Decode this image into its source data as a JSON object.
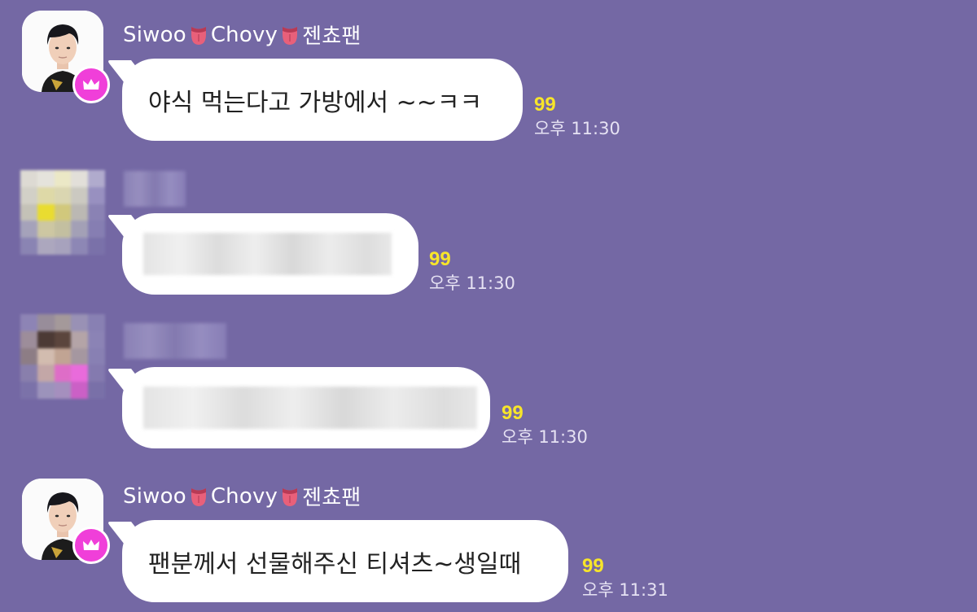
{
  "messages": [
    {
      "sender": "Siwoo",
      "sender_mid": "Chovy",
      "sender_suffix": "젠쵸팬",
      "text": "야식 먹는다고 가방에서 ~~ㅋㅋ",
      "unread": "99",
      "time": "오후 11:30"
    },
    {
      "blurred": true,
      "unread": "99",
      "time": "오후 11:30"
    },
    {
      "blurred": true,
      "unread": "99",
      "time": "오후 11:30"
    },
    {
      "sender": "Siwoo",
      "sender_mid": "Chovy",
      "sender_suffix": "젠쵸팬",
      "text": "팬분께서 선물해주신 티셔츠~생일때",
      "unread": "99",
      "time": "오후 11:31"
    }
  ],
  "colors": {
    "background": "#7468a4",
    "bubble": "#ffffff",
    "unread": "#f7e52a",
    "crown_badge": "#f03fd9"
  },
  "icons": [
    "profile-avatar",
    "crown-icon",
    "tongue-emoji-icon"
  ]
}
